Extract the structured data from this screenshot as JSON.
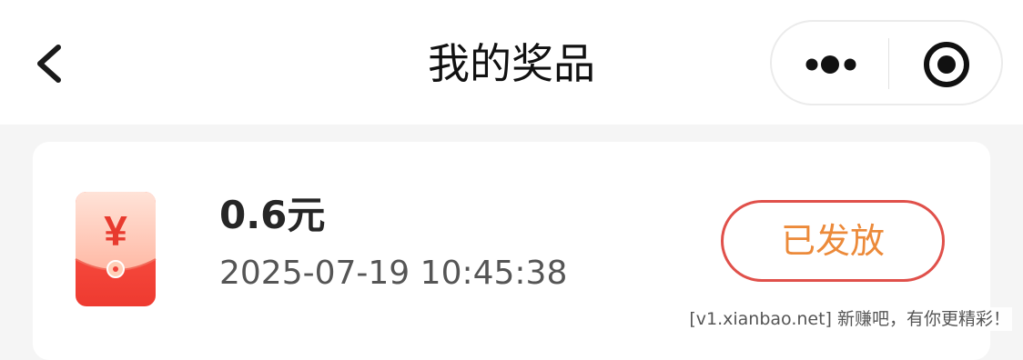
{
  "header": {
    "title": "我的奖品",
    "back_icon": "chevron-left-icon",
    "more_icon": "more-dots-icon",
    "close_icon": "target-close-icon"
  },
  "prizes": [
    {
      "amount": "0.6元",
      "timestamp": "2025-07-19 10:45:38",
      "status": "已发放",
      "icon": "red-packet-icon",
      "icon_symbol": "¥"
    }
  ],
  "watermark": "[v1.xianbao.net] 新赚吧，有你更精彩！",
  "colors": {
    "status_border": "#e0504a",
    "status_text": "#ec8a3a",
    "packet_red": "#f0443c",
    "page_background": "#f5f5f5"
  }
}
